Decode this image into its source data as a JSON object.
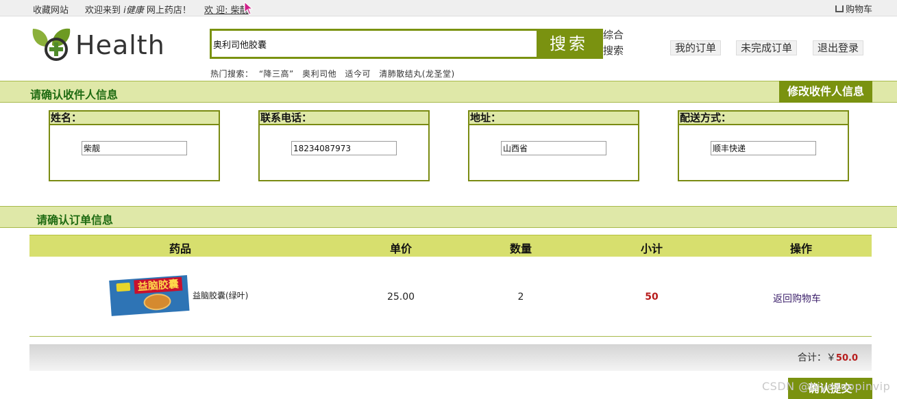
{
  "topbar": {
    "bookmark": "收藏网站",
    "welcome_prefix": "欢迎来到",
    "welcome_brand": "i健康",
    "welcome_suffix": "网上药店！",
    "user_greeting": "欢 迎: 柴靓",
    "cart": "购物车"
  },
  "header": {
    "logo_text": "Health",
    "search_value": "奥利司他胶囊",
    "search_button": "搜索",
    "advanced_search": "综合搜索",
    "hot_label": "热门搜索：",
    "hot_items": [
      "“降三高”",
      "奥利司他",
      "适今可",
      "清肺散结丸(龙圣堂)"
    ],
    "nav": {
      "my_orders": "我的订单",
      "unfinished_orders": "未完成订单",
      "logout": "退出登录"
    }
  },
  "receiver": {
    "section_title": "请确认收件人信息",
    "edit_button": "修改收件人信息",
    "fields": [
      {
        "label": "姓名：",
        "value": "柴靓"
      },
      {
        "label": "联系电话：",
        "value": "18234087973"
      },
      {
        "label": "地址：",
        "value": "山西省"
      },
      {
        "label": "配送方式：",
        "value": "顺丰快递"
      }
    ]
  },
  "order": {
    "section_title": "请确认订单信息",
    "columns": [
      "药品",
      "单价",
      "数量",
      "小计",
      "操作"
    ],
    "rows": [
      {
        "product_box_text": "益脑胶囊",
        "name": "益脑胶囊(绿叶)",
        "price": "25.00",
        "quantity": "2",
        "subtotal": "50",
        "action": "返回购物车"
      }
    ],
    "total_label": "合计：￥",
    "total_value": "50.0",
    "submit_button": "确认提交"
  },
  "watermark": "CSDN @biyezuopinvip",
  "colors": {
    "brand_green": "#7a9210",
    "section_bg": "#dfe8a8",
    "table_head": "#d7df6e",
    "price_red": "#b71c1c"
  }
}
